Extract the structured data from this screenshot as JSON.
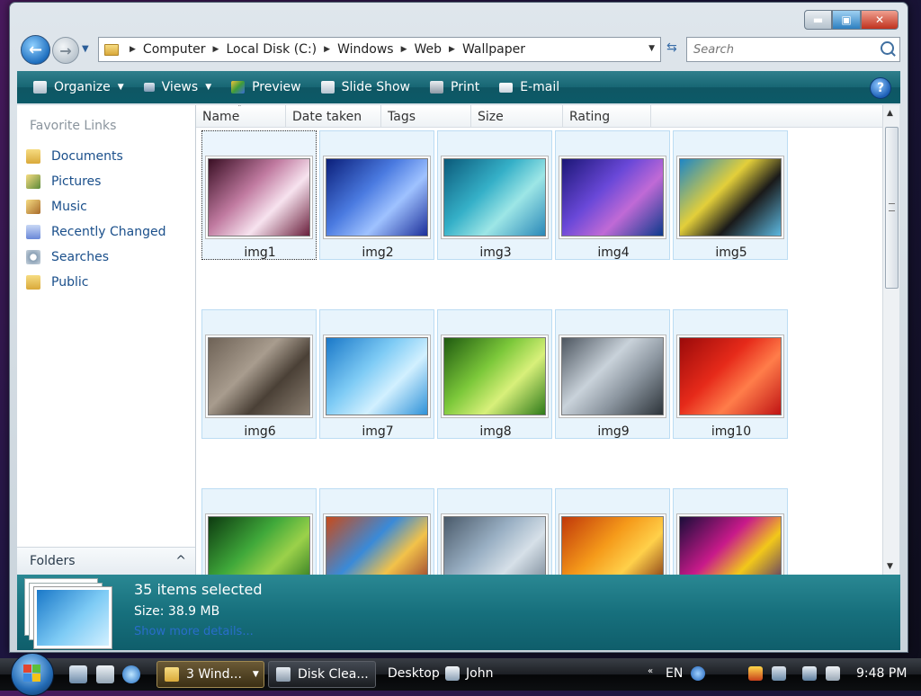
{
  "address": {
    "crumbs": [
      "Computer",
      "Local Disk (C:)",
      "Windows",
      "Web",
      "Wallpaper"
    ]
  },
  "search": {
    "placeholder": "Search"
  },
  "toolbar": {
    "organize": "Organize",
    "views": "Views",
    "preview": "Preview",
    "slideshow": "Slide Show",
    "print": "Print",
    "email": "E-mail",
    "help": "?"
  },
  "nav_pane": {
    "heading": "Favorite Links",
    "items": [
      {
        "label": "Documents",
        "icon": "documents-folder-icon"
      },
      {
        "label": "Pictures",
        "icon": "pictures-folder-icon"
      },
      {
        "label": "Music",
        "icon": "music-folder-icon"
      },
      {
        "label": "Recently Changed",
        "icon": "recent-folder-icon"
      },
      {
        "label": "Searches",
        "icon": "searches-icon"
      },
      {
        "label": "Public",
        "icon": "public-folder-icon"
      }
    ],
    "folders_label": "Folders"
  },
  "columns": [
    "Name",
    "Date taken",
    "Tags",
    "Size",
    "Rating"
  ],
  "files": [
    {
      "label": "img1",
      "colors": [
        "#3a0f24",
        "#c07aa0",
        "#f7e3ef",
        "#6a1f3c"
      ]
    },
    {
      "label": "img2",
      "colors": [
        "#0b1f7a",
        "#4a7ae0",
        "#9fc2ff",
        "#1c2f9a"
      ]
    },
    {
      "label": "img3",
      "colors": [
        "#0b5a7a",
        "#35b0c8",
        "#9de6e6",
        "#2a88b8"
      ]
    },
    {
      "label": "img4",
      "colors": [
        "#1c1777",
        "#6a48d8",
        "#c06ad6",
        "#0d3a8c"
      ]
    },
    {
      "label": "img5",
      "colors": [
        "#1d86c6",
        "#e3cf3a",
        "#1a1a1a",
        "#5cb8e0"
      ]
    },
    {
      "label": "img6",
      "colors": [
        "#6e6256",
        "#a89c8e",
        "#4a4036",
        "#8a7e70"
      ]
    },
    {
      "label": "img7",
      "colors": [
        "#1a78c8",
        "#7ecbf5",
        "#d2f0ff",
        "#2f92d8"
      ]
    },
    {
      "label": "img8",
      "colors": [
        "#1f5a10",
        "#7cc83a",
        "#d8f07a",
        "#2f7a1a"
      ]
    },
    {
      "label": "img9",
      "colors": [
        "#4d5660",
        "#c9d2da",
        "#8a949e",
        "#2d343a"
      ]
    },
    {
      "label": "img10",
      "colors": [
        "#9a0a0a",
        "#e62a1a",
        "#ff7d4a",
        "#c01414"
      ]
    },
    {
      "label": "",
      "colors": [
        "#0d3a10",
        "#3fa83a",
        "#9bd14a",
        "#1c6a1a"
      ]
    },
    {
      "label": "",
      "colors": [
        "#c84a1a",
        "#3a8ad8",
        "#f2c24a",
        "#8a2a2a"
      ]
    },
    {
      "label": "",
      "colors": [
        "#4a5a6a",
        "#9ab0c4",
        "#d6e0e8",
        "#6a7a8a"
      ]
    },
    {
      "label": "",
      "colors": [
        "#c0380a",
        "#f59a1a",
        "#ffd04a",
        "#6a1a0a"
      ]
    },
    {
      "label": "",
      "colors": [
        "#1a0d3a",
        "#c81a8a",
        "#f2c81a",
        "#3a1a7a"
      ]
    }
  ],
  "details": {
    "title": "35 items selected",
    "size": "Size: 38.9 MB",
    "link": "Show more details..."
  },
  "taskbar": {
    "tasks": [
      {
        "label": "3 Wind...",
        "state": "active"
      },
      {
        "label": "Disk Clea...",
        "state": "normal"
      }
    ],
    "desktop": "Desktop",
    "user": "John",
    "lang": "EN",
    "clock": "9:48 PM"
  },
  "colors": {
    "accent": "#176674",
    "link": "#1a4f8b",
    "selection": "#e8f4fc"
  }
}
